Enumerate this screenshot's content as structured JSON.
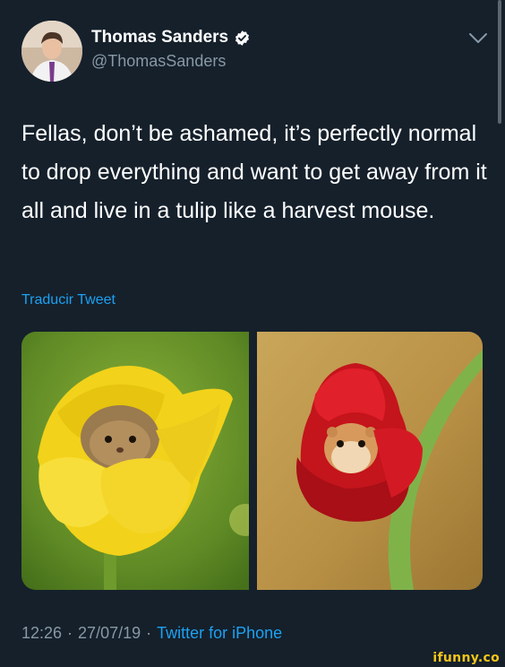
{
  "tweet": {
    "display_name": "Thomas Sanders",
    "handle": "@ThomasSanders",
    "text": "Fellas, don’t be ashamed, it’s perfectly normal to drop everything and want to get away from it all and live in a tulip like a harvest mouse.",
    "translate_label": "Traducir Tweet",
    "time": "12:26",
    "date": "27/07/19",
    "source": "Twitter for iPhone",
    "separator": "·"
  },
  "icons": {
    "verified": "verified-badge-icon",
    "menu": "chevron-down-icon"
  },
  "colors": {
    "background": "#15202b",
    "text_primary": "#ffffff",
    "text_secondary": "#8899a6",
    "link": "#1da1f2"
  },
  "watermark": "ifunny.co"
}
